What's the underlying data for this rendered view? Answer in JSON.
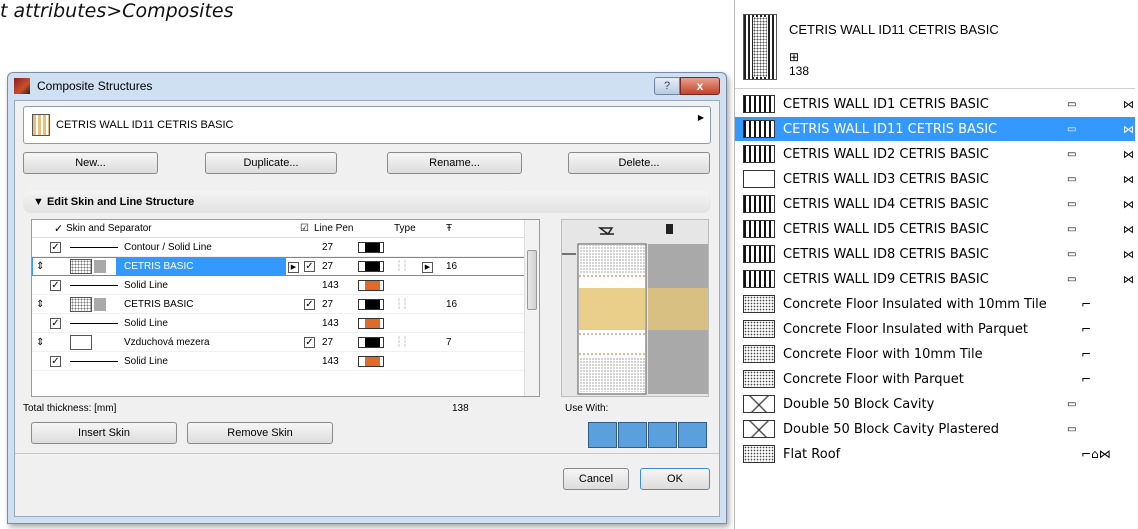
{
  "caption": "t attributes>Composites",
  "dialog": {
    "title": "Composite Structures",
    "help": "?",
    "close": "x",
    "selected_composite": "CETRIS WALL ID11 CETRIS BASIC",
    "buttons": {
      "new": "New...",
      "duplicate": "Duplicate...",
      "rename": "Rename...",
      "delete": "Delete..."
    },
    "section_title": "Edit Skin and Line Structure",
    "columns": {
      "skin": "Skin and Separator",
      "line_pen": "Line Pen",
      "type": "Type"
    },
    "rows": [
      {
        "name": "Contour / Solid Line",
        "kind": "line",
        "pen": "27"
      },
      {
        "name": "CETRIS BASIC",
        "kind": "skin",
        "pen": "27",
        "thickness": "16",
        "selected": true
      },
      {
        "name": "Solid Line",
        "kind": "line",
        "pen": "143"
      },
      {
        "name": "CETRIS BASIC",
        "kind": "skin",
        "pen": "27",
        "thickness": "16"
      },
      {
        "name": "Solid Line",
        "kind": "line",
        "pen": "143"
      },
      {
        "name": "Vzduchová mezera",
        "kind": "skin",
        "pen": "27",
        "thickness": "7"
      },
      {
        "name": "Solid Line",
        "kind": "line",
        "pen": "143"
      }
    ],
    "total_label": "Total thickness: [mm]",
    "total_value": "138",
    "use_with": "Use With:",
    "insert_skin": "Insert Skin",
    "remove_skin": "Remove Skin",
    "cancel": "Cancel",
    "ok": "OK"
  },
  "panel": {
    "header_name": "CETRIS WALL ID11 CETRIS BASIC",
    "header_thickness": "138",
    "items": [
      {
        "name": "CETRIS WALL ID1 CETRIS BASIC",
        "sw": "wall"
      },
      {
        "name": "CETRIS WALL ID11 CETRIS BASIC",
        "sw": "wall",
        "selected": true
      },
      {
        "name": "CETRIS WALL ID2 CETRIS BASIC",
        "sw": "wall"
      },
      {
        "name": "CETRIS WALL ID3 CETRIS BASIC",
        "sw": "blank"
      },
      {
        "name": "CETRIS WALL ID4 CETRIS BASIC",
        "sw": "wall"
      },
      {
        "name": "CETRIS WALL ID5 CETRIS BASIC",
        "sw": "wall"
      },
      {
        "name": "CETRIS WALL ID8 CETRIS BASIC",
        "sw": "wall"
      },
      {
        "name": "CETRIS WALL ID9 CETRIS BASIC",
        "sw": "wall"
      },
      {
        "name": "Concrete Floor Insulated with 10mm Tile",
        "sw": "dots"
      },
      {
        "name": "Concrete Floor Insulated with Parquet",
        "sw": "dots"
      },
      {
        "name": "Concrete Floor with 10mm Tile",
        "sw": "dots"
      },
      {
        "name": "Concrete Floor with Parquet",
        "sw": "dots"
      },
      {
        "name": "Double 50 Block Cavity",
        "sw": "block"
      },
      {
        "name": "Double 50 Block Cavity Plastered",
        "sw": "block"
      },
      {
        "name": "Flat Roof",
        "sw": "dots"
      }
    ]
  }
}
